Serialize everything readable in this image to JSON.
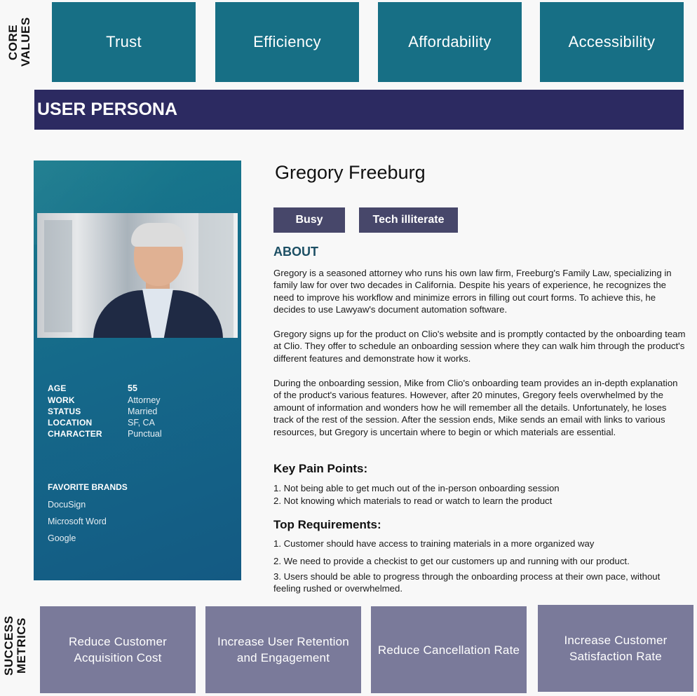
{
  "core_values": {
    "label": "CORE VALUES",
    "items": [
      "Trust",
      "Efficiency",
      "Affordability",
      "Accessibility"
    ]
  },
  "persona_bar": {
    "title": "USER PERSONA"
  },
  "profile": {
    "details": [
      {
        "key": "AGE",
        "value": "55"
      },
      {
        "key": "WORK",
        "value": "Attorney"
      },
      {
        "key": "STATUS",
        "value": "Married"
      },
      {
        "key": "LOCATION",
        "value": "SF, CA"
      },
      {
        "key": "CHARACTER",
        "value": "Punctual"
      }
    ],
    "favorite_brands_title": "FAVORITE BRANDS",
    "brands": [
      "DocuSign",
      "Microsoft Word",
      "Google"
    ]
  },
  "persona": {
    "name": "Gregory Freeburg",
    "tags": [
      "Busy",
      "Tech illiterate"
    ],
    "about_title": "ABOUT",
    "about": [
      "Gregory is a seasoned attorney who runs his own law firm, Freeburg's Family Law, specializing in family law for over two decades in California. Despite his years of experience, he recognizes the need to improve his workflow and minimize errors in filling out court forms. To achieve this, he decides to use Lawyaw's document automation software.",
      "Gregory signs up for the product on Clio's website and is promptly contacted by the onboarding team at Clio. They offer to schedule an onboarding session where they can walk him through the product's different features and demonstrate how it works.",
      "During the onboarding session, Mike from Clio's onboarding team provides an in-depth explanation of the product's various features. However, after 20 minutes, Gregory feels overwhelmed by the amount of information and wonders how he will remember all the details. Unfortunately, he loses track of the rest of the session. After the session ends, Mike sends an email with links to various resources, but Gregory is uncertain where to begin or which materials are essential."
    ],
    "pain_points_title": "Key Pain Points:",
    "pain_points": [
      "1. Not being able to get much out of the in-person onboarding session",
      "2. Not knowing which materials to read or watch to learn the product"
    ],
    "requirements_title": "Top Requirements:",
    "requirements": [
      "1. Customer should have access to training materials in a more organized way",
      "2. We need to provide a checkist to get our customers up and running with our product.",
      "3. Users should be able to progress through the onboarding process at their own pace, without feeling rushed or overwhelmed."
    ]
  },
  "success_metrics": {
    "label": "SUCCESS METRICS",
    "items": [
      "Reduce Customer Acquisition Cost",
      "Increase User Retention and Engagement",
      "Reduce Cancellation Rate",
      "Increase Customer Satisfaction Rate"
    ]
  },
  "colors": {
    "core_value_bg": "#176f85",
    "persona_bar_bg": "#2c2a61",
    "tag_bg": "#47476a",
    "metric_bg": "#7a7a9a",
    "about_heading": "#1c4f64"
  }
}
